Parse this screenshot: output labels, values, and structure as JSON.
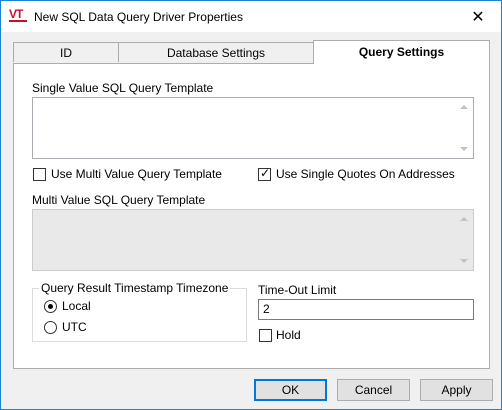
{
  "window": {
    "title": "New SQL Data Query Driver Properties",
    "close_glyph": "✕"
  },
  "tabs": [
    {
      "label": "ID"
    },
    {
      "label": "Database Settings"
    },
    {
      "label": "Query Settings"
    }
  ],
  "query_settings": {
    "single_label": "Single Value SQL Query Template",
    "single_value": "",
    "use_multi_label": "Use Multi Value Query Template",
    "use_multi_checked": false,
    "use_single_quotes_label": "Use Single Quotes On Addresses",
    "use_single_quotes_checked": true,
    "multi_label": "Multi Value SQL Query Template",
    "multi_value": "",
    "timezone_group_title": "Query Result Timestamp Timezone",
    "timezone_options": [
      {
        "label": "Local",
        "selected": true
      },
      {
        "label": "UTC",
        "selected": false
      }
    ],
    "timeout_label": "Time-Out Limit",
    "timeout_value": "2",
    "hold_label": "Hold",
    "hold_checked": false
  },
  "buttons": {
    "ok": "OK",
    "cancel": "Cancel",
    "apply": "Apply"
  }
}
